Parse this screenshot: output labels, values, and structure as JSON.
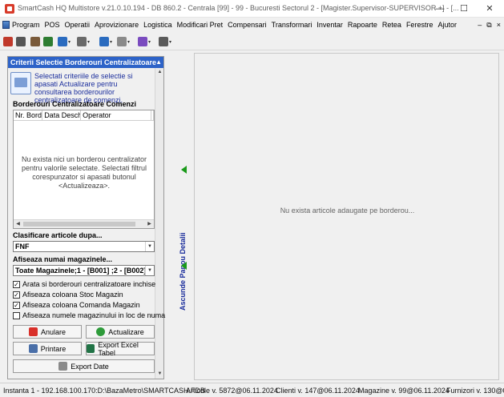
{
  "window": {
    "title": "SmartCash HQ Multistore v.21.0.10.194 - DB 860.2 - Centrala [99] - 99 - Bucuresti Sectorul 2 - [Magister.Supervisor-SUPERVISOR +] - [...",
    "min_glyph": "—",
    "max_glyph": "☐",
    "close_glyph": "✕"
  },
  "menu": {
    "items": [
      "Program",
      "POS",
      "Operatii",
      "Aprovizionare",
      "Logistica",
      "Modificari Pret",
      "Compensari",
      "Transformari",
      "Inventar",
      "Rapoarte",
      "Retea",
      "Ferestre",
      "Ajutor"
    ],
    "mdi_min": "–",
    "mdi_restore": "⧉",
    "mdi_close": "×"
  },
  "toolbar": {
    "icons": [
      "cash-register-icon",
      "pos-icon",
      "warehouse-icon",
      "users-icon",
      "transfer-icon",
      "document-icon",
      "reports-icon",
      "tools-icon",
      "settings-icon",
      "window-icon"
    ],
    "colors": [
      "#c0392b",
      "#555555",
      "#7a5a3a",
      "#2e7d32",
      "#2a6bbf",
      "#6a6a6a",
      "#2a6bbf",
      "#8a8a8a",
      "#7a4bbf",
      "#5a5a5a"
    ]
  },
  "left_panel": {
    "header": "Criterii Selectie Borderouri Centralizatoare",
    "info_text": "Selectati criteriile de selectie si apasati Actualizare pentru consultarea borderourilor centralizatoare de comenzi.",
    "grid": {
      "title": "Borderouri Centralizatoare Comenzi",
      "columns": [
        "Nr. Borde",
        "Data Deschi",
        "Operator",
        "I"
      ],
      "empty_message": "Nu exista nici un borderou centralizator pentru valorile selectate. Selectati filtrul corespunzator si apasati butonul <Actualizeaza>."
    },
    "clasificare": {
      "label": "Clasificare articole dupa...",
      "value": "FNF"
    },
    "magazine": {
      "label": "Afiseaza numai magazinele...",
      "value": "Toate Magazinele;1 - [B001] ;2 - [B002]"
    },
    "checkboxes": [
      {
        "label": "Arata si borderouri centralizatoare inchise",
        "checked": "✓"
      },
      {
        "label": "Afiseaza coloana Stoc Magazin",
        "checked": "✓"
      },
      {
        "label": "Afiseaza coloana Comanda Magazin",
        "checked": "✓"
      },
      {
        "label": "Afiseaza numele magazinului in loc de numa",
        "checked": ""
      }
    ],
    "buttons": {
      "anulare": "Anulare",
      "actualizare": "Actualizare",
      "printare": "Printare",
      "export_excel": "Export Excel Tabel",
      "export_date": "Export Date"
    }
  },
  "splitter": {
    "label": "Ascunde Panou Detalii"
  },
  "right_panel": {
    "empty_message": "Nu exista articole adaugate pe borderou..."
  },
  "status": {
    "instance": "Instanta 1 - 192.168.100.170:D:\\BazaMetro\\SMARTCASH.FDB",
    "articole": "Articole v. 5872@06.11.2024",
    "clienti": "Clienti v. 147@06.11.2024",
    "magazine": "Magazine v. 99@06.11.2024",
    "furnizori": "Furnizori v. 130@0"
  }
}
